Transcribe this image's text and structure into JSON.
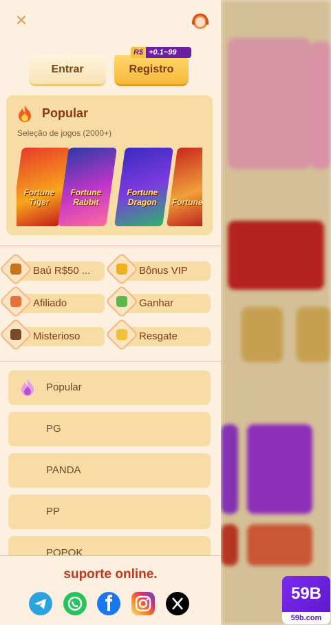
{
  "auth": {
    "login_label": "Entrar",
    "register_label": "Registro",
    "promo_currency": "R$",
    "promo_text": "+0.1~99"
  },
  "popular_card": {
    "title": "Popular",
    "subtitle": "Seleção de jogos (2000+)",
    "games": [
      {
        "label": "Fortune Tiger",
        "icon": "fortune-tiger-thumbnail"
      },
      {
        "label": "Fortune Rabbit",
        "icon": "fortune-rabbit-thumbnail"
      },
      {
        "label": "Fortune Dragon",
        "icon": "fortune-dragon-thumbnail"
      },
      {
        "label": "Fortune Ox",
        "icon": "fortune-ox-thumbnail"
      }
    ]
  },
  "features": [
    {
      "label": "Baú R$50 ...",
      "icon": "chest-icon"
    },
    {
      "label": "Bônus VIP",
      "icon": "crown-icon"
    },
    {
      "label": "Afiliado",
      "icon": "affiliate-icon"
    },
    {
      "label": "Ganhar",
      "icon": "money-icon"
    },
    {
      "label": "Misterioso",
      "icon": "mystery-icon"
    },
    {
      "label": "Resgate",
      "icon": "gold-coins-icon"
    }
  ],
  "categories": [
    {
      "label": "Popular"
    },
    {
      "label": "PG"
    },
    {
      "label": "PANDA"
    },
    {
      "label": "PP"
    },
    {
      "label": "POPOK"
    }
  ],
  "footer": {
    "support_text": "suporte online.",
    "socials": [
      "telegram-icon",
      "whatsapp-icon",
      "facebook-icon",
      "instagram-icon",
      "x-icon"
    ]
  },
  "brand": {
    "logo_text": "59B",
    "domain": "59b.com"
  },
  "colors": {
    "accent": "#c0391c",
    "card_bg": "#f7dca5",
    "drawer_bg": "#fdf0e0",
    "register_bg": "#f6b93a"
  }
}
